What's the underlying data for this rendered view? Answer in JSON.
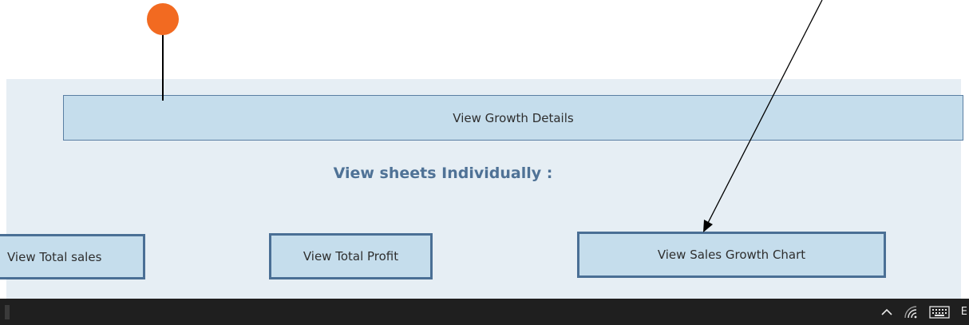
{
  "panel": {
    "growth_button_label": "View Growth Details",
    "section_title": "View sheets Individually :",
    "sheet_buttons": {
      "total_sales": "View Total sales",
      "total_profit": "View Total Profit",
      "sales_growth_chart": "View Sales Growth Chart"
    }
  },
  "taskbar": {
    "tray_icons": [
      "chevron-up-icon",
      "wifi-icon",
      "keyboard-icon"
    ],
    "tray_text": "E"
  },
  "annotations": {
    "marker_color": "#f26a21",
    "arrow_color": "#000000"
  },
  "colors": {
    "panel_background": "#e6eef4",
    "button_fill": "#c5ddec",
    "button_border": "#4a6f95",
    "section_title": "#4f7296",
    "taskbar": "#1f1f1f"
  }
}
